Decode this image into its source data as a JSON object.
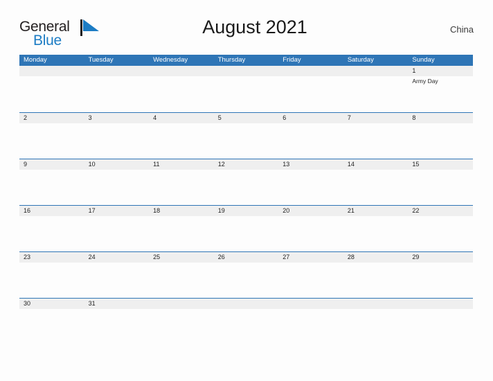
{
  "brand": {
    "name_part1": "General",
    "name_part2": "Blue",
    "flag_icon": "blue-triangle-flag",
    "color_primary": "#1c7cc4",
    "color_text": "#231f20"
  },
  "header": {
    "title": "August 2021",
    "country": "China"
  },
  "calendar": {
    "header_bg": "#2e75b6",
    "daynum_bg": "#efefef",
    "weekdays": [
      "Monday",
      "Tuesday",
      "Wednesday",
      "Thursday",
      "Friday",
      "Saturday",
      "Sunday"
    ],
    "weeks": [
      {
        "days": [
          {
            "num": "",
            "event": ""
          },
          {
            "num": "",
            "event": ""
          },
          {
            "num": "",
            "event": ""
          },
          {
            "num": "",
            "event": ""
          },
          {
            "num": "",
            "event": ""
          },
          {
            "num": "",
            "event": ""
          },
          {
            "num": "1",
            "event": "Army Day"
          }
        ]
      },
      {
        "days": [
          {
            "num": "2",
            "event": ""
          },
          {
            "num": "3",
            "event": ""
          },
          {
            "num": "4",
            "event": ""
          },
          {
            "num": "5",
            "event": ""
          },
          {
            "num": "6",
            "event": ""
          },
          {
            "num": "7",
            "event": ""
          },
          {
            "num": "8",
            "event": ""
          }
        ]
      },
      {
        "days": [
          {
            "num": "9",
            "event": ""
          },
          {
            "num": "10",
            "event": ""
          },
          {
            "num": "11",
            "event": ""
          },
          {
            "num": "12",
            "event": ""
          },
          {
            "num": "13",
            "event": ""
          },
          {
            "num": "14",
            "event": ""
          },
          {
            "num": "15",
            "event": ""
          }
        ]
      },
      {
        "days": [
          {
            "num": "16",
            "event": ""
          },
          {
            "num": "17",
            "event": ""
          },
          {
            "num": "18",
            "event": ""
          },
          {
            "num": "19",
            "event": ""
          },
          {
            "num": "20",
            "event": ""
          },
          {
            "num": "21",
            "event": ""
          },
          {
            "num": "22",
            "event": ""
          }
        ]
      },
      {
        "days": [
          {
            "num": "23",
            "event": ""
          },
          {
            "num": "24",
            "event": ""
          },
          {
            "num": "25",
            "event": ""
          },
          {
            "num": "26",
            "event": ""
          },
          {
            "num": "27",
            "event": ""
          },
          {
            "num": "28",
            "event": ""
          },
          {
            "num": "29",
            "event": ""
          }
        ]
      },
      {
        "days": [
          {
            "num": "30",
            "event": ""
          },
          {
            "num": "31",
            "event": ""
          },
          {
            "num": "",
            "event": ""
          },
          {
            "num": "",
            "event": ""
          },
          {
            "num": "",
            "event": ""
          },
          {
            "num": "",
            "event": ""
          },
          {
            "num": "",
            "event": ""
          }
        ]
      }
    ]
  }
}
